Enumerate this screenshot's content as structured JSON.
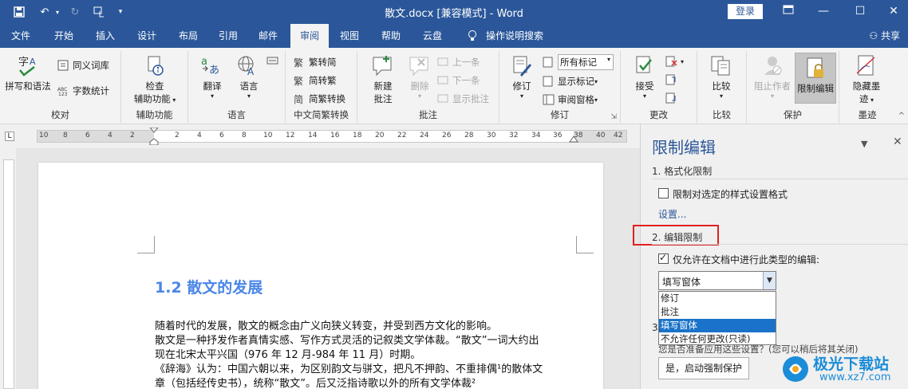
{
  "titlebar": {
    "doc_title": "散文.docx [兼容模式] - Word",
    "login": "登录",
    "quick_access": [
      "save-icon",
      "undo-icon",
      "redo-icon",
      "touch-mode-icon",
      "customize-icon"
    ]
  },
  "tabs": [
    "文件",
    "开始",
    "插入",
    "设计",
    "布局",
    "引用",
    "邮件",
    "审阅",
    "视图",
    "帮助",
    "云盘",
    "操作说明搜索"
  ],
  "active_tab": "审阅",
  "share": "共享",
  "ribbon": {
    "proofing": {
      "spell": "拼写和语法",
      "thesaurus": "同义词库",
      "wordcount": "字数统计",
      "label": "校对"
    },
    "accessibility": {
      "check": "检查",
      "check2": "辅助功能",
      "label": "辅助功能"
    },
    "language": {
      "translate": "翻译",
      "language": "语言",
      "label": "语言"
    },
    "chinese": {
      "t2s": "繁转简",
      "s2t": "简转繁",
      "convert": "简繁转换",
      "label": "中文简繁转换"
    },
    "comments": {
      "new": "新建",
      "new2": "批注",
      "delete": "删除",
      "prev": "上一条",
      "next": "下一条",
      "show": "显示批注",
      "label": "批注"
    },
    "tracking": {
      "track": "修订",
      "markup": "所有标记",
      "show_markup": "显示标记",
      "review_pane": "审阅窗格",
      "label": "修订"
    },
    "changes": {
      "accept": "接受",
      "label": "更改"
    },
    "compare": {
      "compare": "比较",
      "label": "比较"
    },
    "protect": {
      "block": "阻止作者",
      "restrict": "限制编辑",
      "label": "保护"
    },
    "ink": {
      "hide": "隐藏墨",
      "hide2": "迹",
      "label": "墨迹"
    }
  },
  "ruler": {
    "left_numbers": [
      "10",
      "8",
      "6",
      "4",
      "2"
    ],
    "right_numbers": [
      "2",
      "4",
      "6",
      "8",
      "10",
      "12",
      "14",
      "16",
      "18",
      "20",
      "22",
      "24",
      "26",
      "28",
      "30",
      "32",
      "34",
      "36",
      "38",
      "40",
      "42"
    ]
  },
  "document": {
    "heading": "1.2 散文的发展",
    "lines": [
      "随着时代的发展，散文的概念由广义向狭义转变，并受到西方文化的影响。",
      "散文是一种抒发作者真情实感、写作方式灵活的记叙类文学体裁。“散文”一词大约出",
      "现在北宋太平兴国（976 年 12 月-984 年 11 月）时期。",
      "《辞海》认为：中国六朝以来，为区别韵文与骈文，把凡不押韵、不重排偶¹的散体文",
      "章（包括经传史书），统称“散文”。后又泛指诗歌以外的所有文学体裁²"
    ]
  },
  "pane": {
    "title": "限制编辑",
    "section1": "1. 格式化限制",
    "format_checkbox": "限制对选定的样式设置格式",
    "settings_link": "设置...",
    "section2": "2. 编辑限制",
    "edit_checkbox": "仅允许在文档中进行此类型的编辑:",
    "combo_value": "填写窗体",
    "options": [
      "修订",
      "批注",
      "填写窗体",
      "不允许任何更改(只读)"
    ],
    "selected_option": "填写窗体",
    "section3_prefix": "3.",
    "note": "您是否准备应用这些设置？(您可以稍后将其关闭)",
    "start_button": "是，启动强制保护"
  },
  "watermark": {
    "text": "极光下载站",
    "url": "www.xz7.com"
  },
  "colors": {
    "accent": "#2b579a",
    "highlight": "#e02020",
    "selected": "#1a73c8"
  }
}
